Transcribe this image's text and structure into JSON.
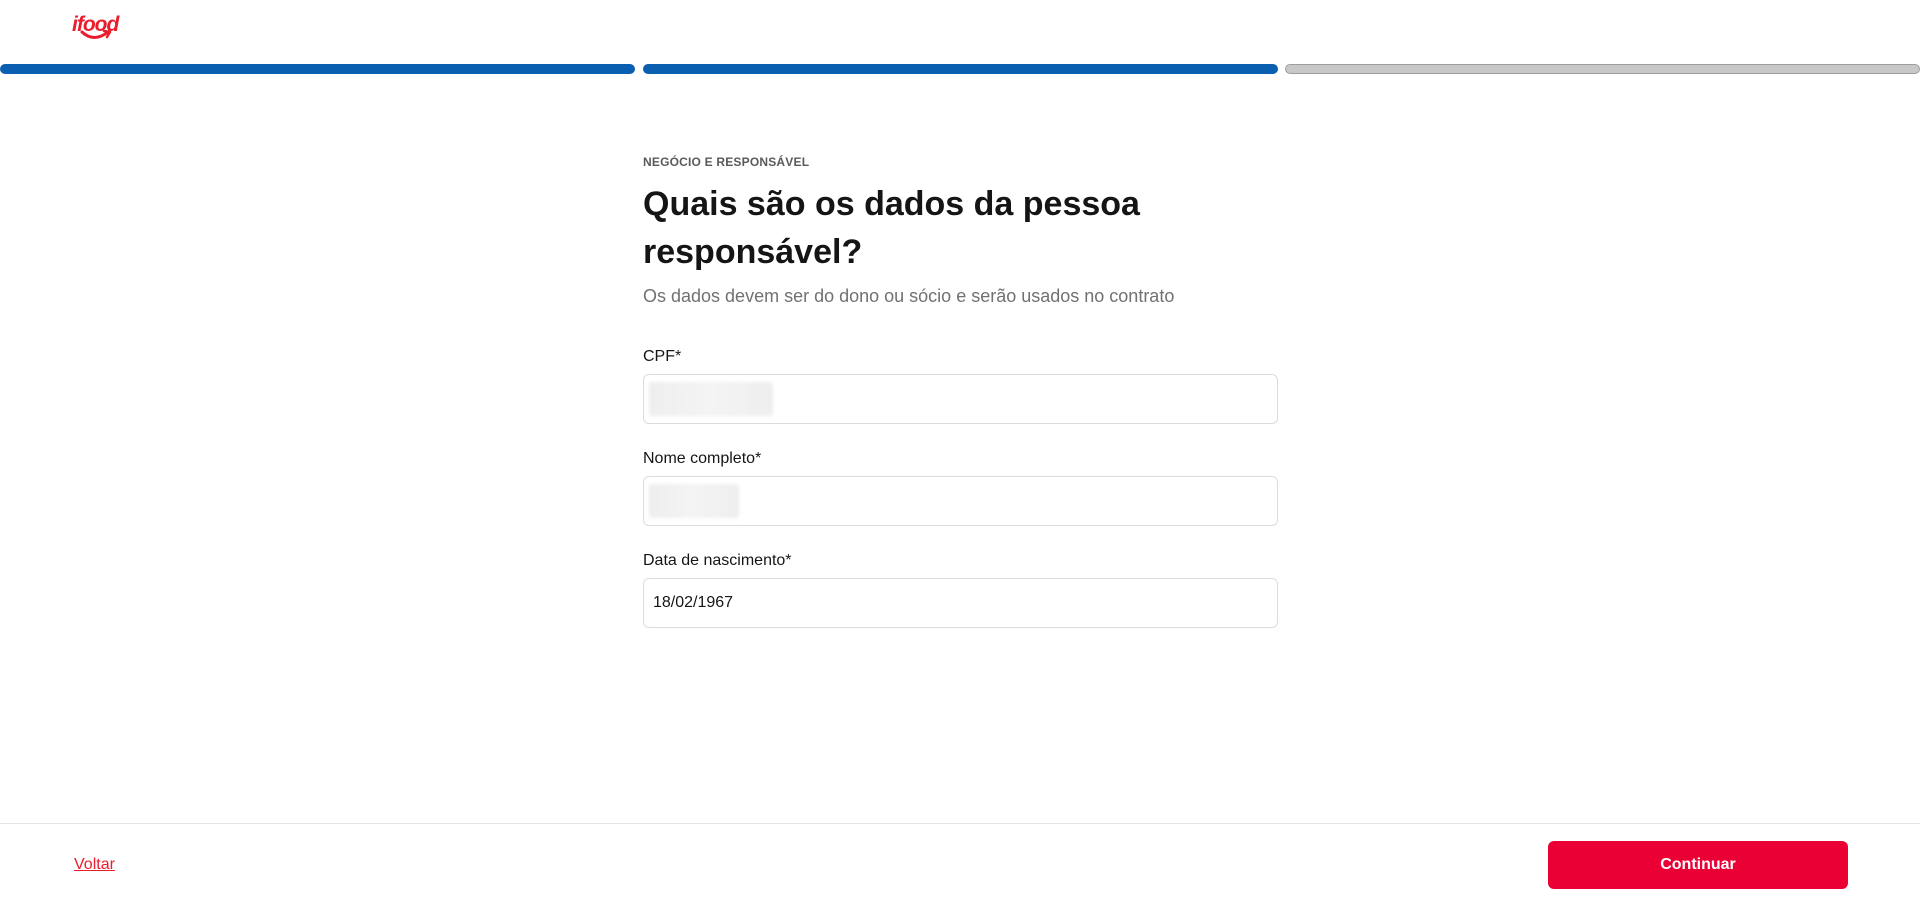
{
  "header": {
    "logo_text": "ifood",
    "brand_color": "#ea1d2c"
  },
  "progress": {
    "total_steps": 3,
    "completed_steps": 2,
    "active_color": "#0b5fb0",
    "inactive_color": "#c8c8c8"
  },
  "form": {
    "section_label": "NEGÓCIO E RESPONSÁVEL",
    "title": "Quais são os dados da pessoa responsável?",
    "subtitle": "Os dados devem ser do dono ou sócio e serão usados no contrato",
    "fields": [
      {
        "label": "CPF*",
        "value": ""
      },
      {
        "label": "Nome completo*",
        "value": ""
      },
      {
        "label": "Data de nascimento*",
        "value": "18/02/1967"
      }
    ]
  },
  "footer": {
    "back_label": "Voltar",
    "continue_label": "Continuar",
    "continue_color": "#ea0035"
  }
}
